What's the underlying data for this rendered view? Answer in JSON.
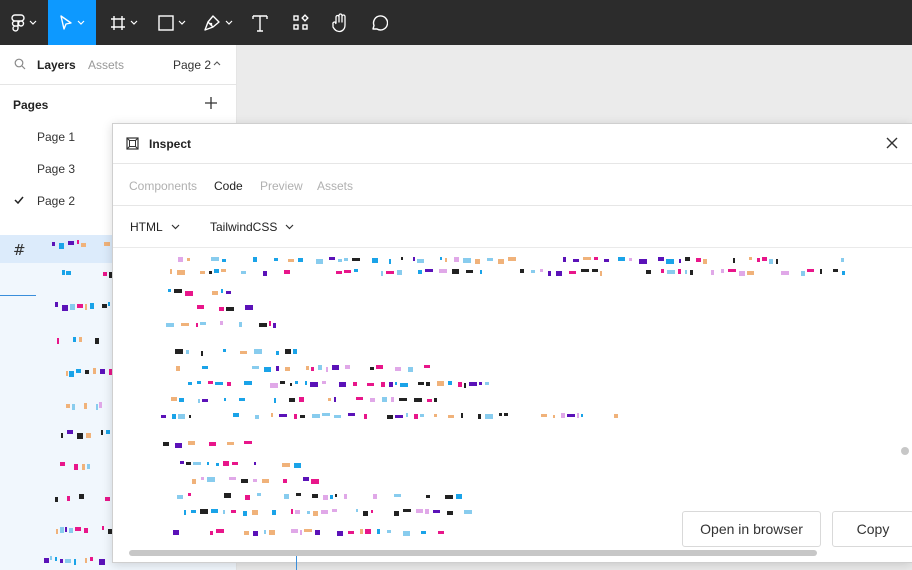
{
  "toolbar": {
    "tools": [
      {
        "icon": "figma-menu-icon"
      },
      {
        "icon": "move-tool-icon",
        "active": true
      },
      {
        "icon": "frame-tool-icon"
      },
      {
        "icon": "shape-tool-icon"
      },
      {
        "icon": "pen-tool-icon"
      },
      {
        "icon": "text-tool-icon"
      },
      {
        "icon": "resources-icon"
      },
      {
        "icon": "hand-tool-icon"
      },
      {
        "icon": "comment-tool-icon"
      }
    ],
    "accent": "#0d99ff",
    "background": "#2c2c2c"
  },
  "left_panel": {
    "tabs": {
      "layers": "Layers",
      "assets": "Assets",
      "current_page": "Page 2"
    },
    "pages_title": "Pages",
    "pages": [
      {
        "label": "Page 1",
        "selected": false
      },
      {
        "label": "Page 3",
        "selected": false
      },
      {
        "label": "Page 2",
        "selected": true
      }
    ],
    "frame_glyph": "#"
  },
  "inspect": {
    "title": "Inspect",
    "tabs": [
      {
        "label": "Components",
        "active": false
      },
      {
        "label": "Code",
        "active": true
      },
      {
        "label": "Preview",
        "active": false
      },
      {
        "label": "Assets",
        "active": false
      }
    ],
    "language_select": "HTML",
    "framework_select": "TailwindCSS",
    "open_browser_label": "Open in browser",
    "copy_label": "Copy"
  },
  "colors": {
    "code_pink": "#e8168a",
    "code_blue": "#1aa3e8",
    "code_purple": "#5b12b8",
    "code_orange": "#f0b27a",
    "code_lilac": "#e0a8e8"
  }
}
